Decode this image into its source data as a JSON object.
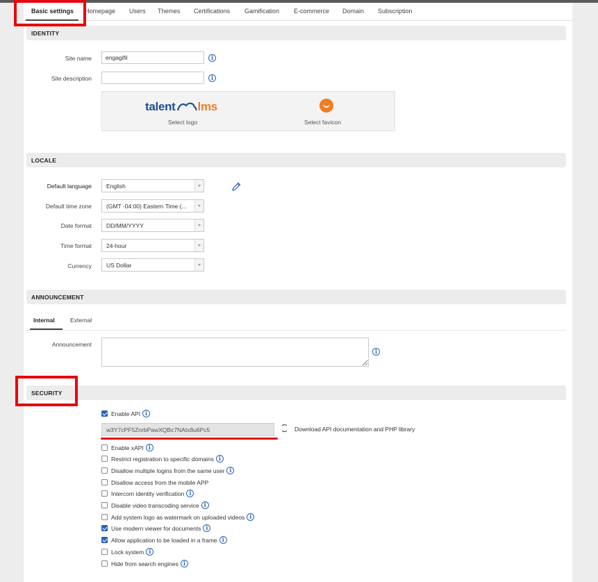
{
  "tabs": [
    "Basic settings",
    "Homepage",
    "Users",
    "Themes",
    "Certifications",
    "Gamification",
    "E-commerce",
    "Domain",
    "Subscription"
  ],
  "identity": {
    "heading": "IDENTITY",
    "site_name_label": "Site name",
    "site_name_value": "engagifil",
    "site_description_label": "Site description",
    "site_description_value": "",
    "logo_brand_left": "talent",
    "logo_brand_right": "lms",
    "select_logo": "Select logo",
    "select_favicon": "Select favicon"
  },
  "locale": {
    "heading": "LOCALE",
    "fields": [
      {
        "label": "Default language",
        "value": "English"
      },
      {
        "label": "Default time zone",
        "value": "(GMT -04:00) Eastern Time (..."
      },
      {
        "label": "Date format",
        "value": "DD/MM/YYYY"
      },
      {
        "label": "Time format",
        "value": "24-hour"
      },
      {
        "label": "Currency",
        "value": "US Dollar"
      }
    ]
  },
  "announcement": {
    "heading": "ANNOUNCEMENT",
    "subtabs": [
      "Internal",
      "External"
    ],
    "label": "Announcement",
    "value": ""
  },
  "security": {
    "heading": "SECURITY",
    "enable_api": {
      "label": "Enable API",
      "checked": true
    },
    "api_key": "w3Y7cPF5ZnrbPawXQBc7NAtx8u6Pc5",
    "download_link": "Download API documentation and PHP library",
    "options": [
      {
        "label": "Enable xAPI",
        "checked": false,
        "info": true
      },
      {
        "label": "Restrict registration to specific domains",
        "checked": false,
        "info": true
      },
      {
        "label": "Disallow multiple logins from the same user",
        "checked": false,
        "info": true
      },
      {
        "label": "Disallow access from the mobile APP",
        "checked": false,
        "info": false
      },
      {
        "label": "Intercom identity verification",
        "checked": false,
        "info": true
      },
      {
        "label": "Disable video transcoding service",
        "checked": false,
        "info": true
      },
      {
        "label": "Add system logo as watermark on uploaded videos",
        "checked": false,
        "info": true
      },
      {
        "label": "Use modern viewer for documents",
        "checked": true,
        "info": true
      },
      {
        "label": "Allow application to be loaded in a frame",
        "checked": true,
        "info": true
      },
      {
        "label": "Lock system",
        "checked": false,
        "info": true
      },
      {
        "label": "Hide from search engines",
        "checked": false,
        "info": true
      }
    ]
  },
  "colors": {
    "highlight": "#e6080c",
    "info_icon": "#2763b3",
    "brand_blue": "#1d4f91",
    "brand_orange": "#ef7d22"
  }
}
